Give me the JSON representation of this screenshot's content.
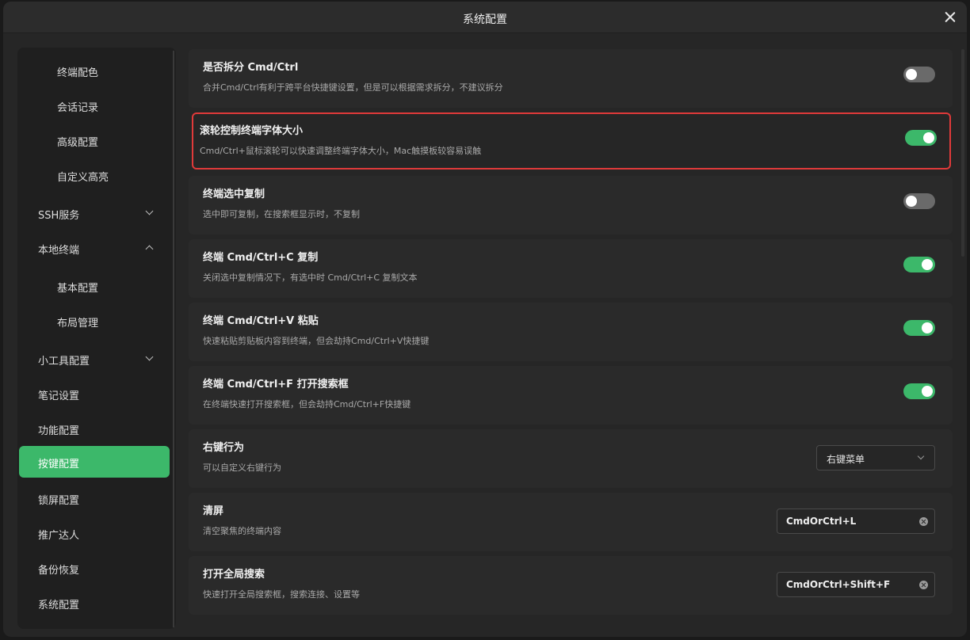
{
  "window": {
    "title": "系统配置"
  },
  "sidebar": {
    "items": [
      {
        "label": "终端配色",
        "level": "sub"
      },
      {
        "label": "会话记录",
        "level": "sub"
      },
      {
        "label": "高级配置",
        "level": "sub"
      },
      {
        "label": "自定义高亮",
        "level": "sub"
      },
      {
        "label": "SSH服务",
        "level": "top",
        "chevron": "down"
      },
      {
        "label": "本地终端",
        "level": "top",
        "chevron": "up"
      },
      {
        "label": "基本配置",
        "level": "sub"
      },
      {
        "label": "布局管理",
        "level": "sub"
      },
      {
        "label": "小工具配置",
        "level": "top",
        "chevron": "down"
      },
      {
        "label": "笔记设置",
        "level": "top"
      },
      {
        "label": "功能配置",
        "level": "top"
      },
      {
        "label": "按键配置",
        "level": "top",
        "active": true
      },
      {
        "label": "锁屏配置",
        "level": "top"
      },
      {
        "label": "推广达人",
        "level": "top"
      },
      {
        "label": "备份恢复",
        "level": "top"
      },
      {
        "label": "系统配置",
        "level": "top"
      }
    ]
  },
  "settings": [
    {
      "title": "是否拆分 Cmd/Ctrl",
      "desc": "合并Cmd/Ctrl有利于跨平台快捷键设置，但是可以根据需求拆分，不建议拆分",
      "control": "toggle",
      "on": false
    },
    {
      "title": "滚轮控制终端字体大小",
      "desc": "Cmd/Ctrl+鼠标滚轮可以快速调整终端字体大小，Mac触摸板较容易误触",
      "control": "toggle",
      "on": true,
      "highlighted": true
    },
    {
      "title": "终端选中复制",
      "desc": "选中即可复制，在搜索框显示时，不复制",
      "control": "toggle",
      "on": false
    },
    {
      "title": "终端 Cmd/Ctrl+C 复制",
      "desc": "关闭选中复制情况下，有选中时 Cmd/Ctrl+C 复制文本",
      "control": "toggle",
      "on": true
    },
    {
      "title": "终端 Cmd/Ctrl+V 粘贴",
      "desc": "快速粘贴剪贴板内容到终端，但会劫持Cmd/Ctrl+V快捷键",
      "control": "toggle",
      "on": true
    },
    {
      "title": "终端 Cmd/Ctrl+F 打开搜索框",
      "desc": "在终端快速打开搜索框，但会劫持Cmd/Ctrl+F快捷键",
      "control": "toggle",
      "on": true
    },
    {
      "title": "右键行为",
      "desc": "可以自定义右键行为",
      "control": "select",
      "value": "右键菜单"
    },
    {
      "title": "清屏",
      "desc": "清空聚焦的终端内容",
      "control": "keyinput",
      "value": "CmdOrCtrl+L"
    },
    {
      "title": "打开全局搜索",
      "desc": "快速打开全局搜索框，搜索连接、设置等",
      "control": "keyinput",
      "value": "CmdOrCtrl+Shift+F"
    }
  ],
  "colors": {
    "accent": "#3cb86a",
    "highlight_border": "#e03a3a"
  }
}
